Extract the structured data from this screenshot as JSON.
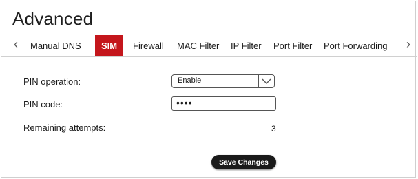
{
  "page": {
    "title": "Advanced"
  },
  "tabs": [
    {
      "label": "Manual DNS",
      "active": false
    },
    {
      "label": "SIM",
      "active": true
    },
    {
      "label": "Firewall",
      "active": false
    },
    {
      "label": "MAC Filter",
      "active": false
    },
    {
      "label": "IP Filter",
      "active": false
    },
    {
      "label": "Port Filter",
      "active": false
    },
    {
      "label": "Port Forwarding",
      "active": false
    }
  ],
  "nav": {
    "prev_icon": "chevron-left-icon",
    "next_icon": "chevron-right-icon"
  },
  "form": {
    "pin_operation": {
      "label": "PIN operation:",
      "value": "Enable"
    },
    "pin_code": {
      "label": "PIN code:",
      "value": "••••"
    },
    "remaining_attempts": {
      "label": "Remaining attempts:",
      "value": "3"
    }
  },
  "actions": {
    "save_label": "Save Changes"
  },
  "colors": {
    "accent": "#c4161c",
    "button": "#1a1a1a"
  }
}
